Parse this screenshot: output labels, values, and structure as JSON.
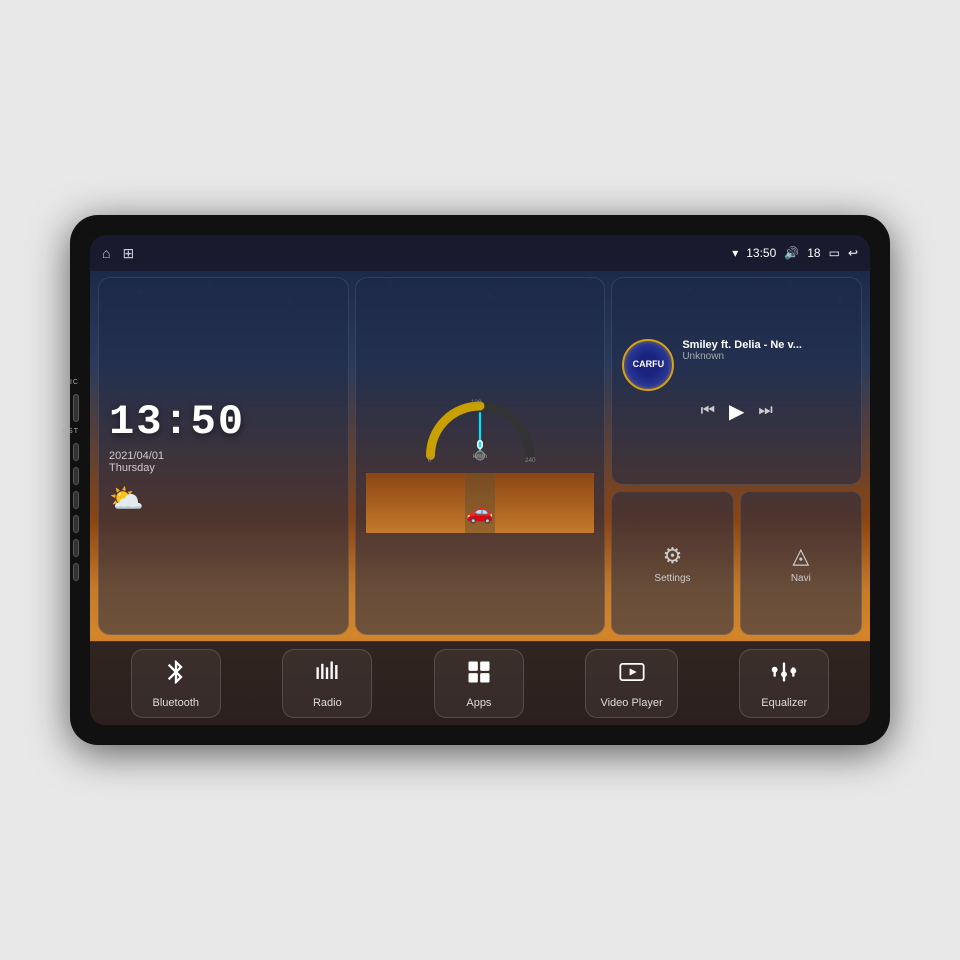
{
  "device": {
    "background_color": "#e8e8e8"
  },
  "topbar": {
    "wifi_icon": "▾",
    "time": "13:50",
    "volume_icon": "🔊",
    "volume_level": "18",
    "window_icon": "▭",
    "back_icon": "↩",
    "home_icon": "⌂",
    "app_icon": "⊞"
  },
  "clock": {
    "time": "13:50",
    "date": "2021/04/01",
    "day": "Thursday"
  },
  "speedometer": {
    "speed": "0",
    "unit": "km/h",
    "max": "240"
  },
  "music": {
    "song_title": "Smiley ft. Delia - Ne v...",
    "artist": "Unknown",
    "album_text": "CARFU"
  },
  "settings": {
    "label": "Settings"
  },
  "navi": {
    "label": "Navi"
  },
  "apps": [
    {
      "id": "bluetooth",
      "label": "Bluetooth",
      "icon": "bluetooth"
    },
    {
      "id": "radio",
      "label": "Radio",
      "icon": "radio"
    },
    {
      "id": "apps",
      "label": "Apps",
      "icon": "apps"
    },
    {
      "id": "video-player",
      "label": "Video Player",
      "icon": "video"
    },
    {
      "id": "equalizer",
      "label": "Equalizer",
      "icon": "equalizer"
    }
  ],
  "side_buttons": {
    "mic_label": "MIC",
    "rst_label": "RST"
  }
}
